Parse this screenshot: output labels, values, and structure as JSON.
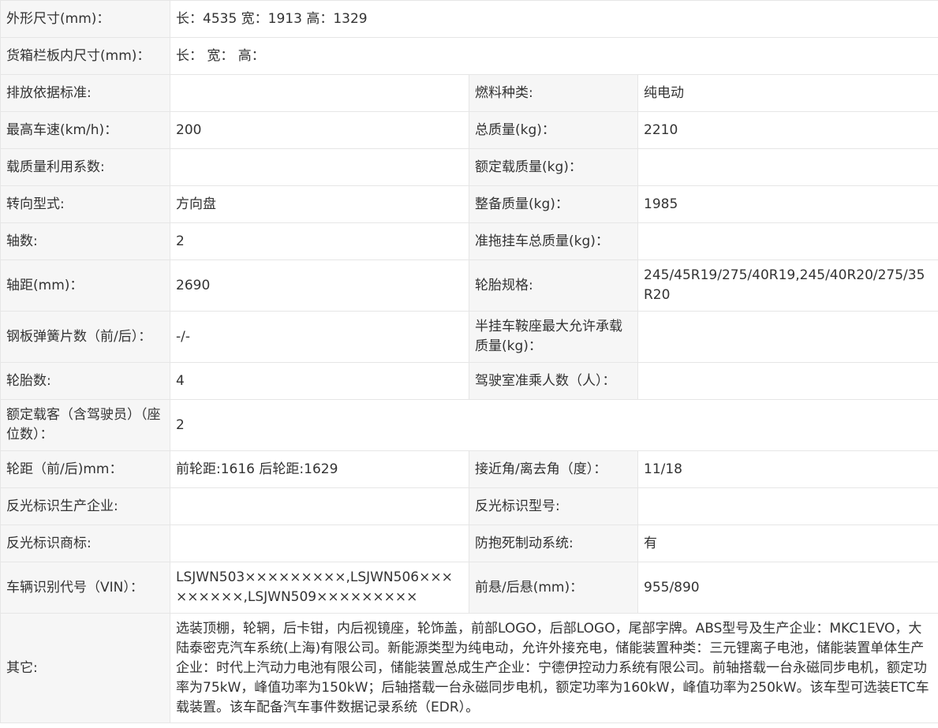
{
  "rows": [
    {
      "type": "full",
      "l": "外形尺寸(mm)：",
      "v": "长：4535 宽：1913 高：1329"
    },
    {
      "type": "full",
      "l": "货箱栏板内尺寸(mm)：",
      "v": "长： 宽： 高："
    },
    {
      "type": "pair",
      "l1": "排放依据标准:",
      "v1": "",
      "l2": "燃料种类:",
      "v2": "纯电动"
    },
    {
      "type": "pair",
      "l1": "最高车速(km/h)：",
      "v1": "200",
      "l2": "总质量(kg)：",
      "v2": "2210"
    },
    {
      "type": "pair",
      "l1": "载质量利用系数:",
      "v1": "",
      "l2": "额定载质量(kg)：",
      "v2": ""
    },
    {
      "type": "pair",
      "l1": "转向型式:",
      "v1": "方向盘",
      "l2": "整备质量(kg)：",
      "v2": "1985"
    },
    {
      "type": "pair",
      "l1": "轴数:",
      "v1": "2",
      "l2": "准拖挂车总质量(kg)：",
      "v2": ""
    },
    {
      "type": "pair",
      "l1": "轴距(mm)：",
      "v1": "2690",
      "l2": "轮胎规格:",
      "v2": "245/45R19/275/40R19,245/40R20/275/35R20"
    },
    {
      "type": "pair",
      "l1": "钢板弹簧片数（前/后）：",
      "v1": "-/-",
      "l2": "半挂车鞍座最大允许承载质量(kg)：",
      "v2": ""
    },
    {
      "type": "pair",
      "l1": "轮胎数:",
      "v1": "4",
      "l2": "驾驶室准乘人数（人）：",
      "v2": ""
    },
    {
      "type": "full",
      "l": "额定载客（含驾驶员）（座位数）：",
      "v": "2"
    },
    {
      "type": "pair",
      "l1": "轮距（前/后)mm：",
      "v1": "前轮距:1616 后轮距:1629",
      "l2": "接近角/离去角（度）：",
      "v2": "11/18"
    },
    {
      "type": "pair",
      "l1": "反光标识生产企业:",
      "v1": "",
      "l2": "反光标识型号:",
      "v2": ""
    },
    {
      "type": "pair",
      "l1": "反光标识商标:",
      "v1": "",
      "l2": "防抱死制动系统:",
      "v2": "有"
    },
    {
      "type": "pair",
      "l1": "车辆识别代号（VIN）：",
      "v1": "LSJWN503×××××××××,LSJWN506×××××××××,LSJWN509×××××××××",
      "l2": "前悬/后悬(mm)：",
      "v2": "955/890"
    },
    {
      "type": "full",
      "l": "其它:",
      "v": "选装顶棚，轮辋，后卡钳，内后视镜座，轮饰盖，前部LOGO，后部LOGO，尾部字牌。ABS型号及生产企业：MKC1EVO，大陆泰密克汽车系统(上海)有限公司。新能源类型为纯电动，允许外接充电，储能装置种类：三元锂离子电池，储能装置单体生产企业：时代上汽动力电池有限公司，储能装置总成生产企业：宁德伊控动力系统有限公司。前轴搭载一台永磁同步电机，额定功率为75kW，峰值功率为150kW；后轴搭载一台永磁同步电机，额定功率为160kW，峰值功率为250kW。该车型可选装ETC车载装置。该车配备汽车事件数据记录系统（EDR）。"
    }
  ]
}
